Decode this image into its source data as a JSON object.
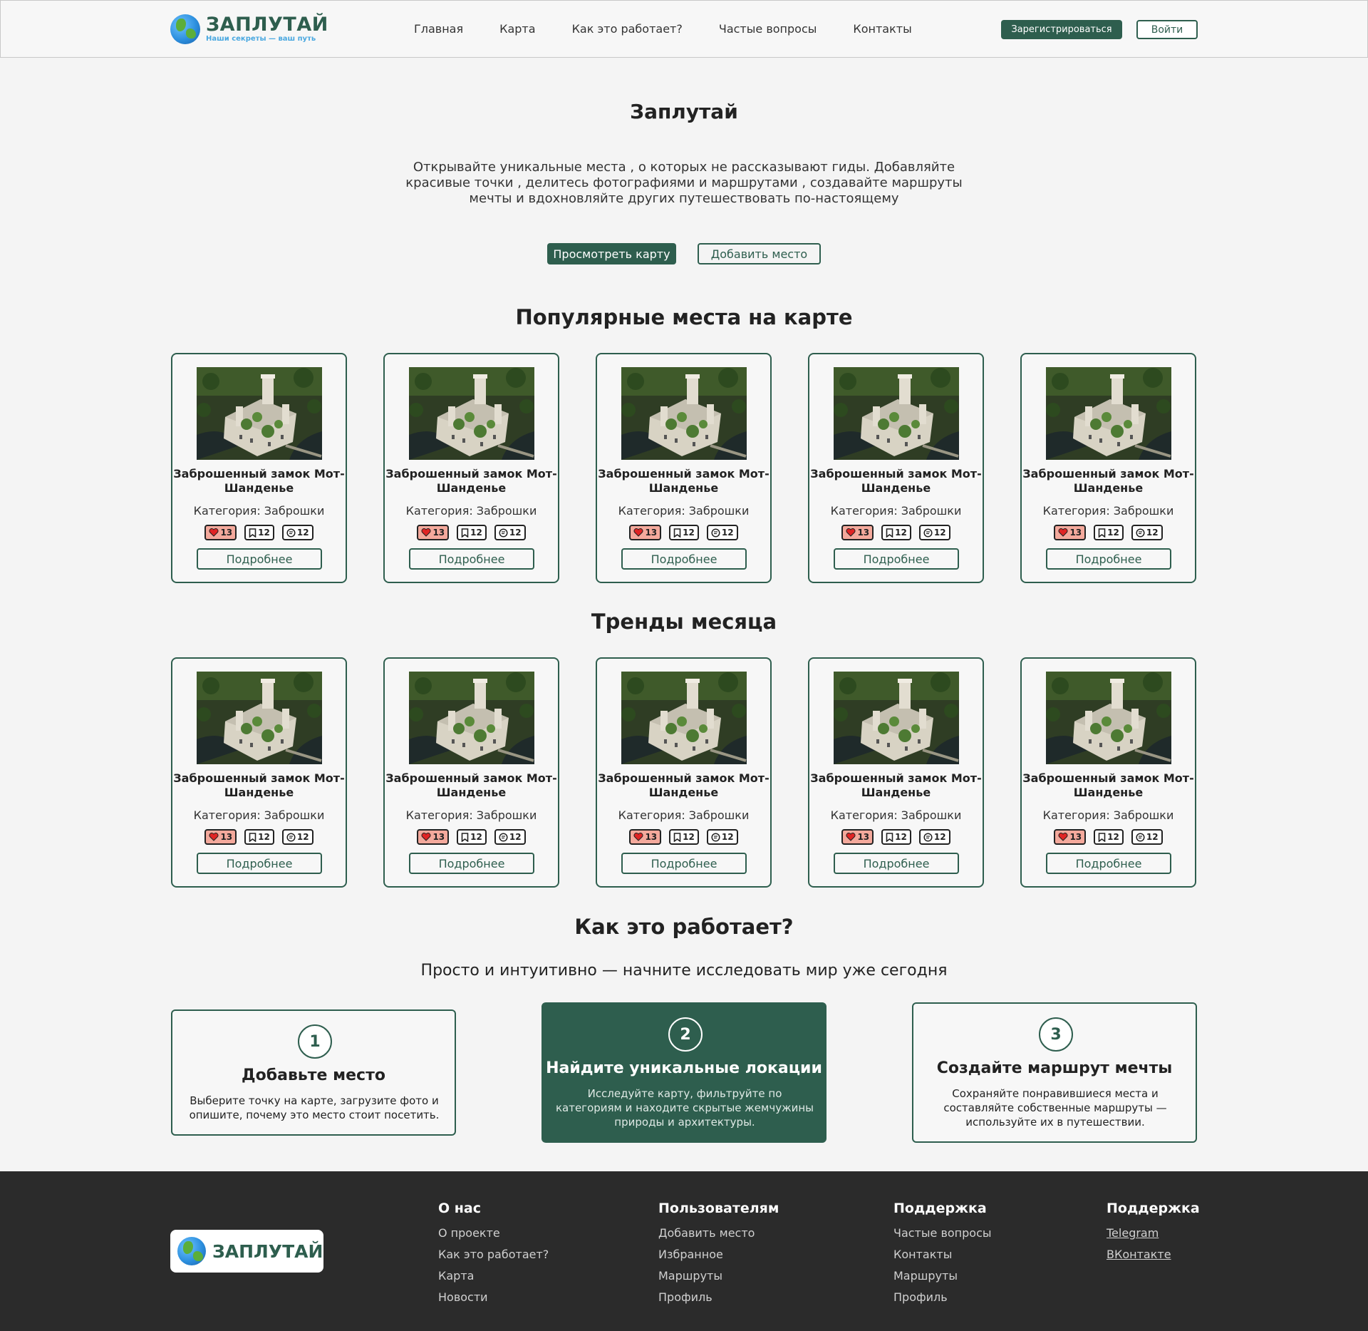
{
  "header": {
    "logo_title": "ЗАПЛУТАЙ",
    "logo_sub": "Наши секреты — ваш путь",
    "nav": [
      "Главная",
      "Карта",
      "Как это работает?",
      "Частые вопросы",
      "Контакты"
    ],
    "register": "Зарегистрироваться",
    "login": "Войти"
  },
  "hero": {
    "title": "Заплутай",
    "description": "Открывайте уникальные места , о которых не рассказывают гиды. Добавляйте красивые точки , делитесь фотографиями и маршрутами , создавайте маршруты мечты и вдохновляйте других путешествовать по-настоящему",
    "btn_map": "Просмотреть карту",
    "btn_add": "Добавить место"
  },
  "popular": {
    "title": "Популярные места на карте",
    "cards": [
      {
        "name": "Заброшенный замок Мот-Шанденье",
        "category": "Категория: Заброшки",
        "likes": "13",
        "saves": "12",
        "comments": "12",
        "more": "Подробнее"
      },
      {
        "name": "Заброшенный замок Мот-Шанденье",
        "category": "Категория: Заброшки",
        "likes": "13",
        "saves": "12",
        "comments": "12",
        "more": "Подробнее"
      },
      {
        "name": "Заброшенный замок Мот-Шанденье",
        "category": "Категория: Заброшки",
        "likes": "13",
        "saves": "12",
        "comments": "12",
        "more": "Подробнее"
      },
      {
        "name": "Заброшенный замок Мот-Шанденье",
        "category": "Категория: Заброшки",
        "likes": "13",
        "saves": "12",
        "comments": "12",
        "more": "Подробнее"
      },
      {
        "name": "Заброшенный замок Мот-Шанденье",
        "category": "Категория: Заброшки",
        "likes": "13",
        "saves": "12",
        "comments": "12",
        "more": "Подробнее"
      }
    ]
  },
  "trends": {
    "title": "Тренды месяца",
    "cards": [
      {
        "name": "Заброшенный замок Мот-Шанденье",
        "category": "Категория: Заброшки",
        "likes": "13",
        "saves": "12",
        "comments": "12",
        "more": "Подробнее"
      },
      {
        "name": "Заброшенный замок Мот-Шанденье",
        "category": "Категория: Заброшки",
        "likes": "13",
        "saves": "12",
        "comments": "12",
        "more": "Подробнее"
      },
      {
        "name": "Заброшенный замок Мот-Шанденье",
        "category": "Категория: Заброшки",
        "likes": "13",
        "saves": "12",
        "comments": "12",
        "more": "Подробнее"
      },
      {
        "name": "Заброшенный замок Мот-Шанденье",
        "category": "Категория: Заброшки",
        "likes": "13",
        "saves": "12",
        "comments": "12",
        "more": "Подробнее"
      },
      {
        "name": "Заброшенный замок Мот-Шанденье",
        "category": "Категория: Заброшки",
        "likes": "13",
        "saves": "12",
        "comments": "12",
        "more": "Подробнее"
      }
    ]
  },
  "how": {
    "title": "Как это работает?",
    "subtitle": "Просто и интуитивно — начните исследовать мир уже сегодня",
    "steps": [
      {
        "num": "1",
        "title": "Добавьте место",
        "desc": "Выберите точку на карте, загрузите фото и опишите, почему это место стоит посетить."
      },
      {
        "num": "2",
        "title": "Найдите уникальные локации",
        "desc": "Исследуйте карту, фильтруйте по категориям и находите скрытые жемчужины природы и архитектуры."
      },
      {
        "num": "3",
        "title": "Создайте маршрут мечты",
        "desc": "Сохраняйте понравившиеся места и составляйте собственные маршруты — используйте их в путешествии."
      }
    ]
  },
  "footer": {
    "logo_title": "ЗАПЛУТАЙ",
    "cols": [
      {
        "title": "О нас",
        "links": [
          "О проекте",
          "Как это работает?",
          "Карта",
          "Новости"
        ]
      },
      {
        "title": "Пользователям",
        "links": [
          "Добавить место",
          "Избранное",
          "Маршруты",
          "Профиль"
        ]
      },
      {
        "title": "Поддержка",
        "links": [
          "Частые вопросы",
          "Контакты",
          "Маршруты",
          "Профиль"
        ]
      },
      {
        "title": "Поддержка",
        "links": [
          "Telegram",
          "ВКонтакте"
        ]
      }
    ]
  },
  "colors": {
    "accent": "#2e5e4e",
    "footer_bg": "#2b2b2b",
    "like_bg": "#f4a99c",
    "page_bg": "#f4f4f4"
  }
}
